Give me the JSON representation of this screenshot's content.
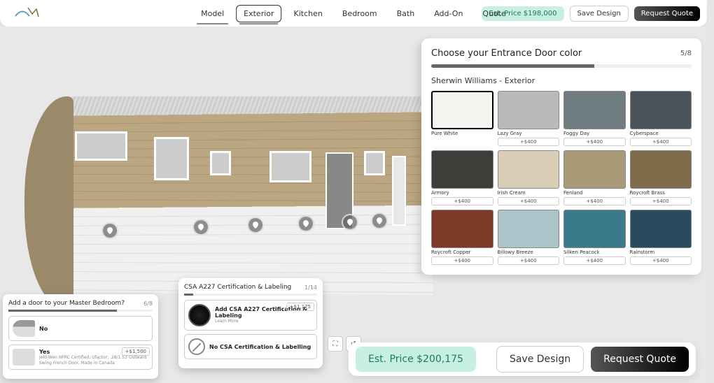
{
  "nav": [
    "Model",
    "Exterior",
    "Kitchen",
    "Bedroom",
    "Bath",
    "Add-On",
    "Quote"
  ],
  "nav_active": 1,
  "top_price": "Est. Price $198,000",
  "save": "Save Design",
  "quote": "Request Quote",
  "panel": {
    "title": "Choose your Entrance Door color",
    "step": "5/8",
    "brand": "Sherwin Williams - Exterior",
    "swatches": [
      {
        "name": "Pure White",
        "color": "#f5f4f0",
        "price": ""
      },
      {
        "name": "Lazy Gray",
        "color": "#b9bbb9",
        "price": "+$400"
      },
      {
        "name": "Foggy Day",
        "color": "#6f7d80",
        "price": "+$400"
      },
      {
        "name": "Cyberspace",
        "color": "#4a525a",
        "price": "+$400"
      },
      {
        "name": "Armory",
        "color": "#3f3d3a",
        "price": "+$400"
      },
      {
        "name": "Irish Cream",
        "color": "#d9cdb5",
        "price": "+$400"
      },
      {
        "name": "Fenland",
        "color": "#a89a76",
        "price": "+$400"
      },
      {
        "name": "Roycroft Brass",
        "color": "#7d6b4a",
        "price": "+$400"
      },
      {
        "name": "Roycroft Copper",
        "color": "#7d3a28",
        "price": "+$400"
      },
      {
        "name": "Billowy Breeze",
        "color": "#aac4c9",
        "price": "+$400"
      },
      {
        "name": "Silken Peacock",
        "color": "#3a7a8a",
        "price": "+$400"
      },
      {
        "name": "Rainstorm",
        "color": "#2a4a5e",
        "price": "+$400"
      }
    ],
    "selected": 0
  },
  "popup_door": {
    "title": "Add a door to your Master Bedroom?",
    "step": "6/8",
    "opts": [
      {
        "label": "No",
        "desc": "",
        "price": ""
      },
      {
        "label": "Yes",
        "desc": "Jeld-Wen NFRC Certified, Ufactor: .28/1.53 Outward Swing French Door. Made in Canada",
        "price": "+$1,500"
      }
    ]
  },
  "popup_cert": {
    "title": "CSA A227 Certification & Labeling",
    "step": "1/14",
    "opts": [
      {
        "label": "Add CSA A227 Certification & Labeling",
        "desc": "Learn More",
        "price": "+$1,175"
      },
      {
        "label": "No CSA Certification & Labelling",
        "desc": "",
        "price": ""
      }
    ]
  },
  "footer_price": "Est. Price $200,175"
}
